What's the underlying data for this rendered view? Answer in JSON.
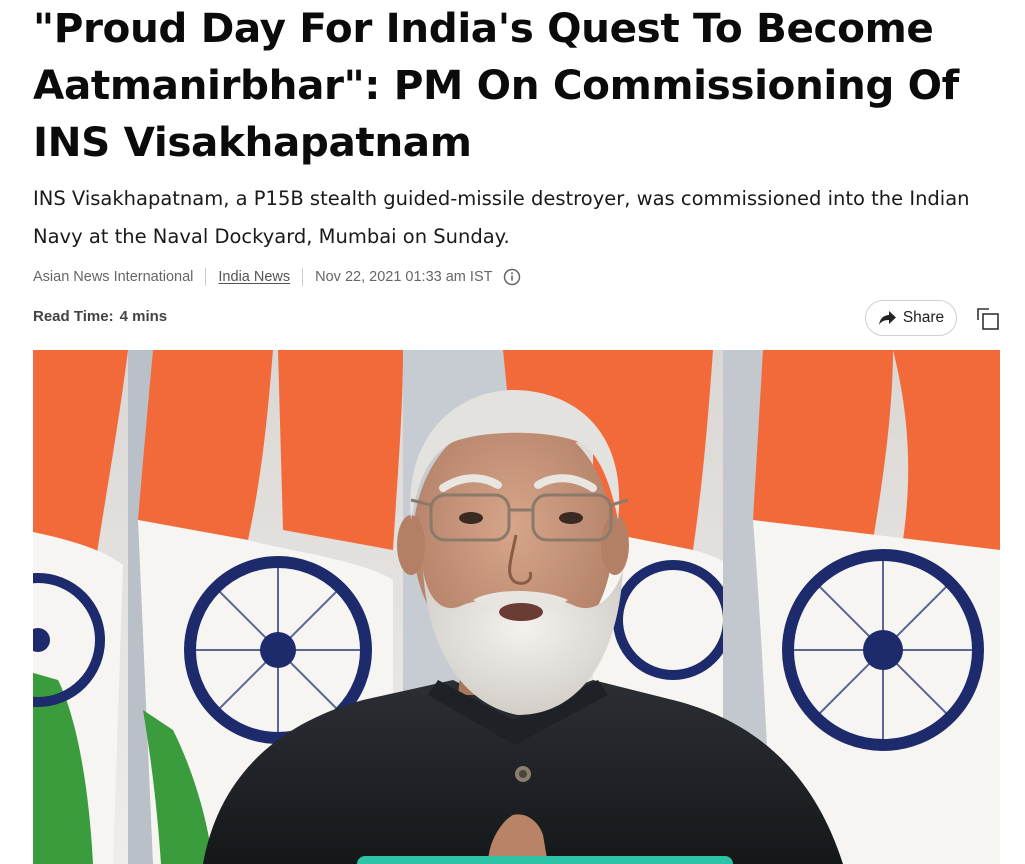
{
  "article": {
    "headline": "\"Proud Day For India's Quest To Become Aatmanirbhar\": PM On Commissioning Of INS Visakhapatnam",
    "standfirst": "INS Visakhapatnam, a P15B stealth guided-missile destroyer, was commissioned into the Indian Navy at the Naval Dockyard, Mumbai on Sunday.",
    "source": "Asian News International",
    "category": "India News",
    "timestamp": "Nov 22, 2021 01:33 am IST",
    "read_time_label": "Read Time:",
    "read_time_value": "4 mins"
  },
  "toolbar": {
    "share_label": "Share"
  },
  "icons": {
    "info": "info-icon",
    "share": "share-arrow-icon",
    "copy": "copy-icon"
  },
  "colors": {
    "saffron": "#f26a3a",
    "india_green": "#3a9c3c",
    "chakra_navy": "#1d2a6b",
    "accent_teal": "#2dc3a7"
  }
}
